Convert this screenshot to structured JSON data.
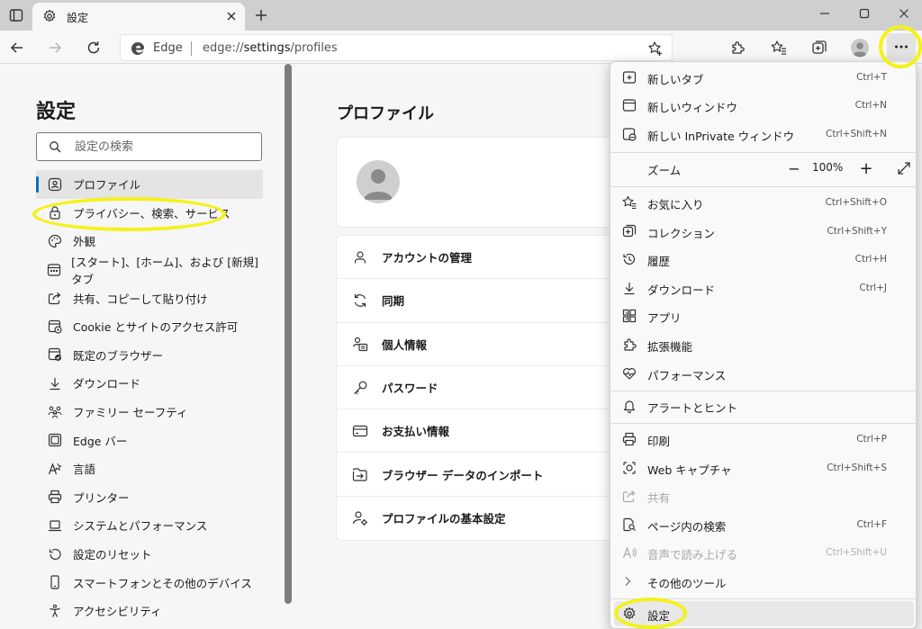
{
  "tab": {
    "title": "設定"
  },
  "address": {
    "site": "Edge",
    "url_prefix": "edge://",
    "url_main": "settings",
    "url_suffix": "/profiles"
  },
  "sidebar": {
    "title": "設定",
    "search_placeholder": "設定の検索",
    "items": [
      {
        "label": "プロファイル",
        "icon": "profile-icon"
      },
      {
        "label": "プライバシー、検索、サービス",
        "icon": "lock-icon"
      },
      {
        "label": "外観",
        "icon": "palette-icon"
      },
      {
        "label": "[スタート]、[ホーム]、および [新規] タブ",
        "icon": "tab-grid-icon"
      },
      {
        "label": "共有、コピーして貼り付け",
        "icon": "share-icon"
      },
      {
        "label": "Cookie とサイトのアクセス許可",
        "icon": "cookie-permissions-icon"
      },
      {
        "label": "既定のブラウザー",
        "icon": "default-browser-icon"
      },
      {
        "label": "ダウンロード",
        "icon": "download-icon"
      },
      {
        "label": "ファミリー セーフティ",
        "icon": "family-icon"
      },
      {
        "label": "Edge バー",
        "icon": "edge-bar-icon"
      },
      {
        "label": "言語",
        "icon": "language-icon"
      },
      {
        "label": "プリンター",
        "icon": "printer-icon"
      },
      {
        "label": "システムとパフォーマンス",
        "icon": "laptop-icon"
      },
      {
        "label": "設定のリセット",
        "icon": "reset-icon"
      },
      {
        "label": "スマートフォンとその他のデバイス",
        "icon": "phone-icon"
      },
      {
        "label": "アクセシビリティ",
        "icon": "accessibility-icon"
      }
    ]
  },
  "main": {
    "title": "プロファイル",
    "profile_rows": [
      {
        "label": "アカウントの管理",
        "icon": "account-icon"
      },
      {
        "label": "同期",
        "icon": "sync-icon"
      },
      {
        "label": "個人情報",
        "icon": "personal-info-icon"
      },
      {
        "label": "パスワード",
        "icon": "key-icon"
      },
      {
        "label": "お支払い情報",
        "icon": "card-icon"
      },
      {
        "label": "ブラウザー データのインポート",
        "icon": "import-icon"
      },
      {
        "label": "プロファイルの基本設定",
        "icon": "profile-settings-icon"
      }
    ]
  },
  "menu": {
    "new_tab": {
      "label": "新しいタブ",
      "shortcut": "Ctrl+T"
    },
    "new_window": {
      "label": "新しいウィンドウ",
      "shortcut": "Ctrl+N"
    },
    "new_inprivate": {
      "label": "新しい InPrivate ウィンドウ",
      "shortcut": "Ctrl+Shift+N"
    },
    "zoom": {
      "label": "ズーム",
      "value": "100%",
      "minus": "−",
      "plus": "+"
    },
    "favorites": {
      "label": "お気に入り",
      "shortcut": "Ctrl+Shift+O"
    },
    "collections": {
      "label": "コレクション",
      "shortcut": "Ctrl+Shift+Y"
    },
    "history": {
      "label": "履歴",
      "shortcut": "Ctrl+H"
    },
    "downloads": {
      "label": "ダウンロード",
      "shortcut": "Ctrl+J"
    },
    "apps": {
      "label": "アプリ"
    },
    "extensions": {
      "label": "拡張機能"
    },
    "performance": {
      "label": "パフォーマンス"
    },
    "alerts": {
      "label": "アラートとヒント"
    },
    "print": {
      "label": "印刷",
      "shortcut": "Ctrl+P"
    },
    "web_capture": {
      "label": "Web キャプチャ",
      "shortcut": "Ctrl+Shift+S"
    },
    "share": {
      "label": "共有"
    },
    "find": {
      "label": "ページ内の検索",
      "shortcut": "Ctrl+F"
    },
    "read_aloud": {
      "label": "音声で読み上げる",
      "shortcut": "Ctrl+Shift+U"
    },
    "more_tools": {
      "label": "その他のツール"
    },
    "settings": {
      "label": "設定"
    }
  },
  "colors": {
    "highlight_ring": "#f3f21a",
    "active_indicator": "#0f6cbd"
  }
}
